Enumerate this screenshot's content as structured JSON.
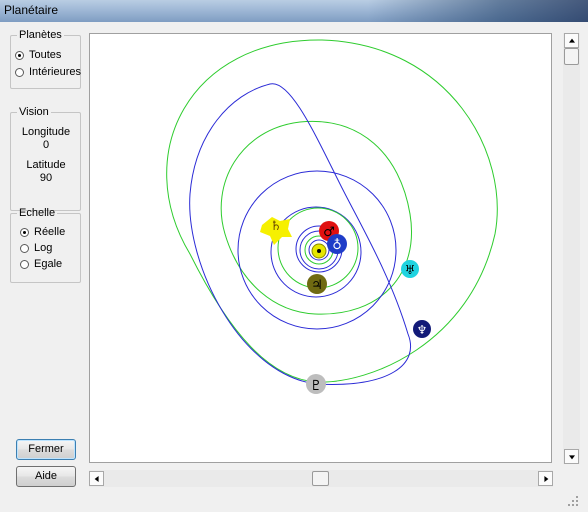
{
  "window": {
    "title": "Planétaire"
  },
  "planetes": {
    "legend": "Planètes",
    "options": [
      {
        "label": "Toutes",
        "checked": true
      },
      {
        "label": "Intérieures",
        "checked": false
      }
    ]
  },
  "vision": {
    "legend": "Vision",
    "longitude_label": "Longitude",
    "longitude_value": "0",
    "latitude_label": "Latitude",
    "latitude_value": "90"
  },
  "echelle": {
    "legend": "Echelle",
    "options": [
      {
        "label": "Réelle",
        "checked": true
      },
      {
        "label": "Log",
        "checked": false
      },
      {
        "label": "Egale",
        "checked": false
      }
    ]
  },
  "buttons": {
    "close": "Fermer",
    "help": "Aide"
  },
  "symbols": {
    "mars": "♂",
    "earth": "♁",
    "saturn": "♄",
    "jupiter": "♃",
    "uranus": "♅",
    "neptune": "♆",
    "pluto": "♇"
  },
  "colors": {
    "orbit_blue": "#2b2bd6",
    "orbit_green": "#2ecc2e",
    "mars": "#e01010",
    "earth": "#1e3cc8",
    "saturn": "#f6f000",
    "jupiter": "#6f6a12",
    "uranus": "#1fd3e0",
    "neptune": "#121a78",
    "pluto": "#bdbdbd",
    "sun": "#e6e600"
  }
}
